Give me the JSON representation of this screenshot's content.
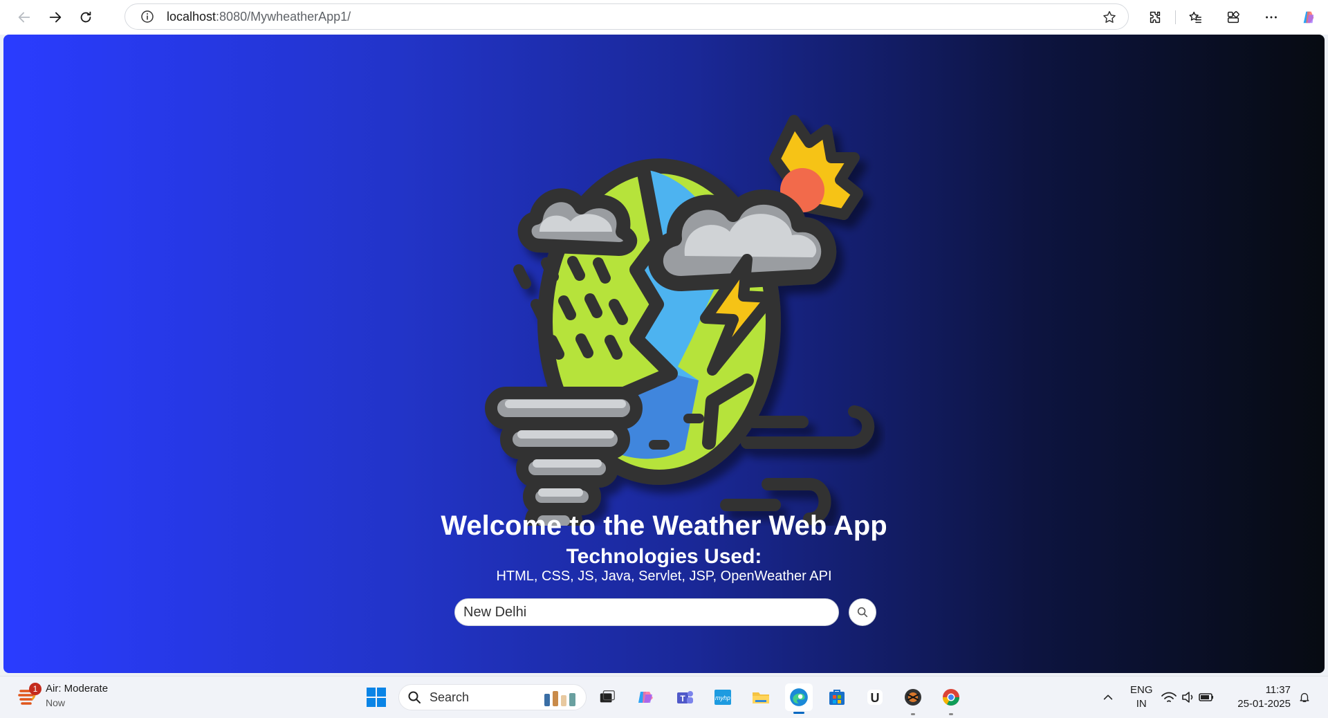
{
  "browser": {
    "url_host": "localhost",
    "url_rest": ":8080/MywheatherApp1/"
  },
  "page": {
    "title": "Welcome to the Weather Web App",
    "subtitle": "Technologies Used:",
    "technologies": "HTML, CSS, JS, Java, Servlet, JSP, OpenWeather API",
    "search": {
      "value": "New Delhi"
    }
  },
  "taskbar": {
    "widget": {
      "badge": "1",
      "title": "Air: Moderate",
      "subtitle": "Now"
    },
    "search_label": "Search",
    "language": "ENG",
    "region": "IN",
    "time": "11:37",
    "date": "25-01-2025"
  },
  "colors": {
    "gradient_start": "#2a3cff",
    "gradient_end": "#070b12",
    "edge_active": "#0067c0"
  },
  "icons": {
    "page": [
      "weather-globe-illustration",
      "search-icon"
    ],
    "toolbar": [
      "back-icon",
      "forward-icon",
      "refresh-icon",
      "info-icon",
      "favorite-star-icon",
      "extensions-icon",
      "favorites-icon",
      "collections-icon",
      "more-icon",
      "copilot-icon"
    ]
  }
}
